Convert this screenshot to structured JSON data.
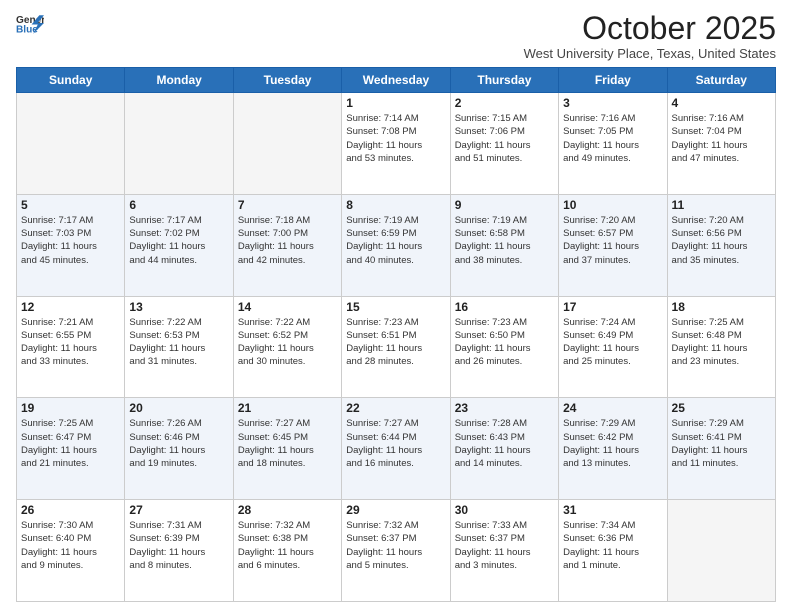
{
  "header": {
    "logo_line1": "General",
    "logo_line2": "Blue",
    "month": "October 2025",
    "location": "West University Place, Texas, United States"
  },
  "days_of_week": [
    "Sunday",
    "Monday",
    "Tuesday",
    "Wednesday",
    "Thursday",
    "Friday",
    "Saturday"
  ],
  "weeks": [
    [
      {
        "day": "",
        "info": ""
      },
      {
        "day": "",
        "info": ""
      },
      {
        "day": "",
        "info": ""
      },
      {
        "day": "1",
        "info": "Sunrise: 7:14 AM\nSunset: 7:08 PM\nDaylight: 11 hours\nand 53 minutes."
      },
      {
        "day": "2",
        "info": "Sunrise: 7:15 AM\nSunset: 7:06 PM\nDaylight: 11 hours\nand 51 minutes."
      },
      {
        "day": "3",
        "info": "Sunrise: 7:16 AM\nSunset: 7:05 PM\nDaylight: 11 hours\nand 49 minutes."
      },
      {
        "day": "4",
        "info": "Sunrise: 7:16 AM\nSunset: 7:04 PM\nDaylight: 11 hours\nand 47 minutes."
      }
    ],
    [
      {
        "day": "5",
        "info": "Sunrise: 7:17 AM\nSunset: 7:03 PM\nDaylight: 11 hours\nand 45 minutes."
      },
      {
        "day": "6",
        "info": "Sunrise: 7:17 AM\nSunset: 7:02 PM\nDaylight: 11 hours\nand 44 minutes."
      },
      {
        "day": "7",
        "info": "Sunrise: 7:18 AM\nSunset: 7:00 PM\nDaylight: 11 hours\nand 42 minutes."
      },
      {
        "day": "8",
        "info": "Sunrise: 7:19 AM\nSunset: 6:59 PM\nDaylight: 11 hours\nand 40 minutes."
      },
      {
        "day": "9",
        "info": "Sunrise: 7:19 AM\nSunset: 6:58 PM\nDaylight: 11 hours\nand 38 minutes."
      },
      {
        "day": "10",
        "info": "Sunrise: 7:20 AM\nSunset: 6:57 PM\nDaylight: 11 hours\nand 37 minutes."
      },
      {
        "day": "11",
        "info": "Sunrise: 7:20 AM\nSunset: 6:56 PM\nDaylight: 11 hours\nand 35 minutes."
      }
    ],
    [
      {
        "day": "12",
        "info": "Sunrise: 7:21 AM\nSunset: 6:55 PM\nDaylight: 11 hours\nand 33 minutes."
      },
      {
        "day": "13",
        "info": "Sunrise: 7:22 AM\nSunset: 6:53 PM\nDaylight: 11 hours\nand 31 minutes."
      },
      {
        "day": "14",
        "info": "Sunrise: 7:22 AM\nSunset: 6:52 PM\nDaylight: 11 hours\nand 30 minutes."
      },
      {
        "day": "15",
        "info": "Sunrise: 7:23 AM\nSunset: 6:51 PM\nDaylight: 11 hours\nand 28 minutes."
      },
      {
        "day": "16",
        "info": "Sunrise: 7:23 AM\nSunset: 6:50 PM\nDaylight: 11 hours\nand 26 minutes."
      },
      {
        "day": "17",
        "info": "Sunrise: 7:24 AM\nSunset: 6:49 PM\nDaylight: 11 hours\nand 25 minutes."
      },
      {
        "day": "18",
        "info": "Sunrise: 7:25 AM\nSunset: 6:48 PM\nDaylight: 11 hours\nand 23 minutes."
      }
    ],
    [
      {
        "day": "19",
        "info": "Sunrise: 7:25 AM\nSunset: 6:47 PM\nDaylight: 11 hours\nand 21 minutes."
      },
      {
        "day": "20",
        "info": "Sunrise: 7:26 AM\nSunset: 6:46 PM\nDaylight: 11 hours\nand 19 minutes."
      },
      {
        "day": "21",
        "info": "Sunrise: 7:27 AM\nSunset: 6:45 PM\nDaylight: 11 hours\nand 18 minutes."
      },
      {
        "day": "22",
        "info": "Sunrise: 7:27 AM\nSunset: 6:44 PM\nDaylight: 11 hours\nand 16 minutes."
      },
      {
        "day": "23",
        "info": "Sunrise: 7:28 AM\nSunset: 6:43 PM\nDaylight: 11 hours\nand 14 minutes."
      },
      {
        "day": "24",
        "info": "Sunrise: 7:29 AM\nSunset: 6:42 PM\nDaylight: 11 hours\nand 13 minutes."
      },
      {
        "day": "25",
        "info": "Sunrise: 7:29 AM\nSunset: 6:41 PM\nDaylight: 11 hours\nand 11 minutes."
      }
    ],
    [
      {
        "day": "26",
        "info": "Sunrise: 7:30 AM\nSunset: 6:40 PM\nDaylight: 11 hours\nand 9 minutes."
      },
      {
        "day": "27",
        "info": "Sunrise: 7:31 AM\nSunset: 6:39 PM\nDaylight: 11 hours\nand 8 minutes."
      },
      {
        "day": "28",
        "info": "Sunrise: 7:32 AM\nSunset: 6:38 PM\nDaylight: 11 hours\nand 6 minutes."
      },
      {
        "day": "29",
        "info": "Sunrise: 7:32 AM\nSunset: 6:37 PM\nDaylight: 11 hours\nand 5 minutes."
      },
      {
        "day": "30",
        "info": "Sunrise: 7:33 AM\nSunset: 6:37 PM\nDaylight: 11 hours\nand 3 minutes."
      },
      {
        "day": "31",
        "info": "Sunrise: 7:34 AM\nSunset: 6:36 PM\nDaylight: 11 hours\nand 1 minute."
      },
      {
        "day": "",
        "info": ""
      }
    ]
  ]
}
